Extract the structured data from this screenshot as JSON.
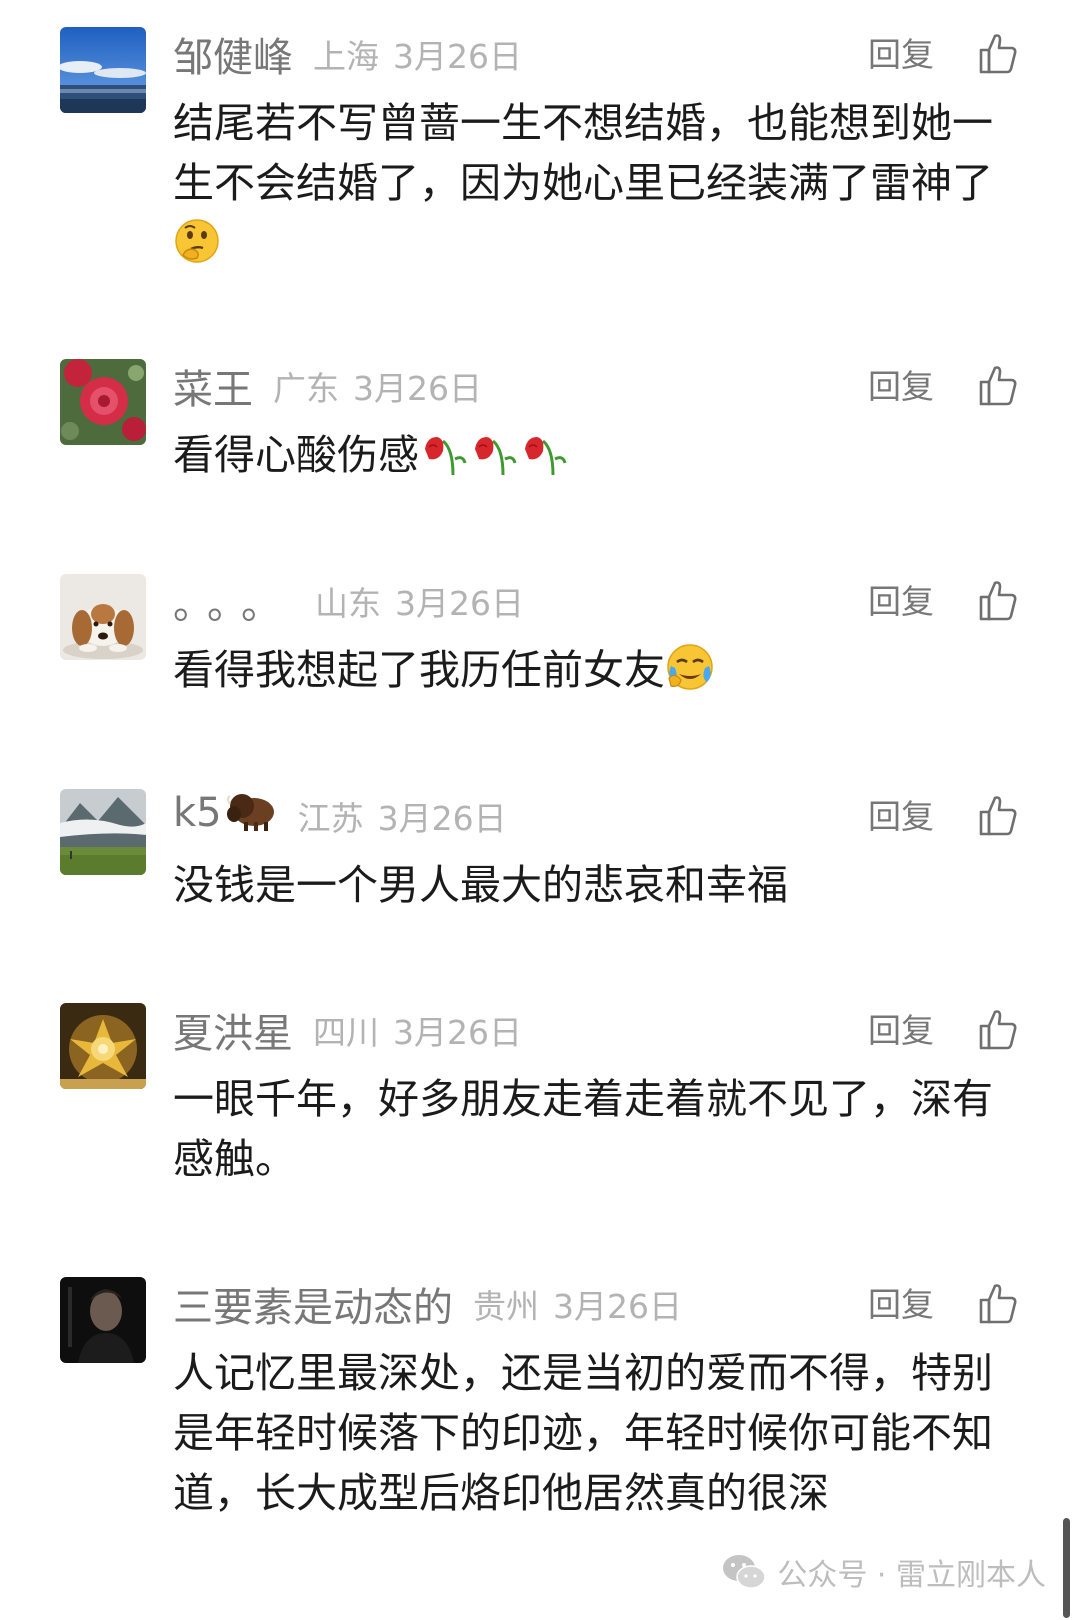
{
  "comments": [
    {
      "name": "邹健峰",
      "location": "上海",
      "date": "3月26日",
      "reply_label": "回复",
      "text": "结尾若不写曾蔷一生不想结婚，也能想到她一生不会结婚了，因为她心里已经装满了雷神了",
      "emoji": "thinking-face",
      "avatar": "sea-landscape"
    },
    {
      "name": "菜王",
      "location": "广东",
      "date": "3月26日",
      "reply_label": "回复",
      "text": "看得心酸伤感",
      "emoji": "wilted-flower x3",
      "avatar": "red-rose"
    },
    {
      "name": "。。。",
      "location": "山东",
      "date": "3月26日",
      "reply_label": "回复",
      "text": "看得我想起了我历任前女友",
      "emoji": "crying-face",
      "avatar": "beagle-dog"
    },
    {
      "name": "k5",
      "name_emoji": "bison",
      "location": "江苏",
      "date": "3月26日",
      "reply_label": "回复",
      "text": "没钱是一个男人最大的悲哀和幸福",
      "avatar": "misty-mountains"
    },
    {
      "name": "夏洪星",
      "location": "四川",
      "date": "3月26日",
      "reply_label": "回复",
      "text": "一眼千年，好多朋友走着走着就不见了，深有感触。",
      "avatar": "golden-lotus"
    },
    {
      "name": "三要素是动态的",
      "location": "贵州",
      "date": "3月26日",
      "reply_label": "回复",
      "text": "人记忆里最深处，还是当初的爱而不得，特别是年轻时候落下的印迹，年轻时候你可能不知道，长大成型后烙印他居然真的很深",
      "avatar": "dark-portrait"
    }
  ],
  "watermark": {
    "text": "公众号 · 雷立刚本人",
    "icon": "wechat-icon"
  },
  "icons": {
    "like": "thumbs-up-icon"
  },
  "colors": {
    "name": "#777777",
    "meta": "#b3b3b3",
    "text": "#1b1b1b",
    "background": "#ffffff"
  }
}
